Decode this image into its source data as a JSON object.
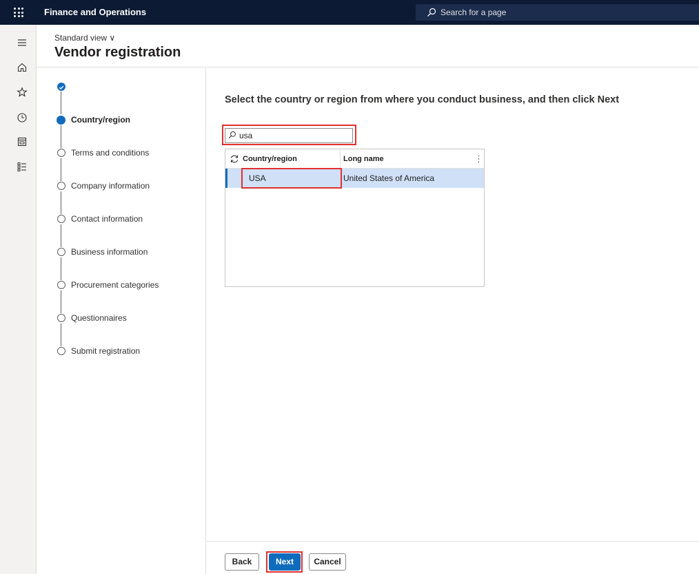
{
  "app": {
    "title": "Finance and Operations",
    "search_placeholder": "Search for a page"
  },
  "nav_rail": {
    "icons": [
      "hamburger-icon",
      "home-icon",
      "star-icon",
      "clock-icon",
      "workspace-icon",
      "list-icon"
    ]
  },
  "header": {
    "view_label": "Standard view ∨",
    "page_title": "Vendor registration"
  },
  "steps": [
    {
      "label": "",
      "state": "done"
    },
    {
      "label": "Country/region",
      "state": "active"
    },
    {
      "label": "Terms and conditions",
      "state": "todo"
    },
    {
      "label": "Company information",
      "state": "todo"
    },
    {
      "label": "Contact information",
      "state": "todo"
    },
    {
      "label": "Business information",
      "state": "todo"
    },
    {
      "label": "Procurement categories",
      "state": "todo"
    },
    {
      "label": "Questionnaires",
      "state": "todo"
    },
    {
      "label": "Submit registration",
      "state": "todo"
    }
  ],
  "main": {
    "instruction": "Select the country or region from where you conduct business, and then click Next",
    "filter_value": "usa",
    "grid": {
      "columns": [
        "Country/region",
        "Long name"
      ],
      "rows": [
        {
          "country": "USA",
          "long_name": "United States of America",
          "selected": true
        }
      ]
    }
  },
  "footer": {
    "back_label": "Back",
    "next_label": "Next",
    "cancel_label": "Cancel"
  },
  "colors": {
    "topbar": "#0c1a33",
    "accent": "#0f6cbd",
    "selected_row": "#cfe0f7",
    "highlight": "#e02f2f"
  }
}
